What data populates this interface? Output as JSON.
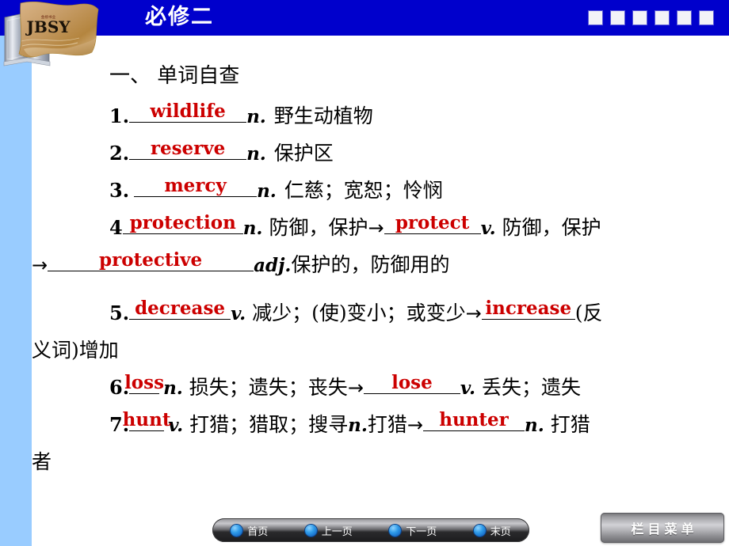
{
  "header": {
    "title": "必修二",
    "square_count": 6,
    "bar_color": "#0000CC",
    "title_color": "#FFFFFF"
  },
  "logo": {
    "brand": "JBSY",
    "sub_brand": "金榜书业",
    "alt": "JBSY book and banner logo"
  },
  "sidebar": {
    "strip_color": "#99CCFF"
  },
  "content": {
    "section_heading": "一、 单词自查",
    "answer_color": "#CC0000",
    "items": [
      {
        "number": "1.",
        "answer": "wildlife",
        "pos": "n.",
        "meaning": "野生动植物"
      },
      {
        "number": "2.",
        "answer": "reserve",
        "pos": "n.",
        "meaning": "保护区"
      },
      {
        "number": "3.",
        "answer": "mercy",
        "pos": "n.",
        "meaning": "仁慈；宽恕；怜悯"
      },
      {
        "number": "4",
        "answer": "protection",
        "pos": "n.",
        "meaning": "防御，保护",
        "arrow": "→",
        "derived_answer": "protect",
        "derived_pos": "v.",
        "derived_meaning": "防御，保护",
        "arrow2": "→",
        "derived2_answer": "protective",
        "derived2_pos": "adj.",
        "derived2_meaning": "保护的，防御用的"
      },
      {
        "number": "5.",
        "answer": "decrease",
        "pos": "v.",
        "meaning": "减少；(使)变小；或变少",
        "arrow": "→",
        "derived_answer": "increase",
        "derived_note_head": "(反",
        "derived_note_tail": "义词)增加"
      },
      {
        "number": "6.",
        "answer": "loss",
        "pos": "n.",
        "meaning": "损失；遗失；丧失",
        "arrow": "→",
        "derived_answer": "lose",
        "derived_pos": "v.",
        "derived_meaning": "丢失；遗失"
      },
      {
        "number": "7.",
        "answer": "hunt",
        "pos": "v.",
        "meaning": "打猎；猎取；搜寻",
        "extra_pos": "n.",
        "extra_meaning": "打猎",
        "arrow": "→",
        "derived_answer": "hunter",
        "derived_pos": "n.",
        "derived_meaning_head": "打猎",
        "derived_meaning_tail": "者"
      }
    ]
  },
  "bottom_nav": {
    "items": [
      {
        "label": "首页"
      },
      {
        "label": "上一页"
      },
      {
        "label": "下一页"
      },
      {
        "label": "末页"
      }
    ]
  },
  "menu_button": {
    "label": "栏目菜单"
  }
}
